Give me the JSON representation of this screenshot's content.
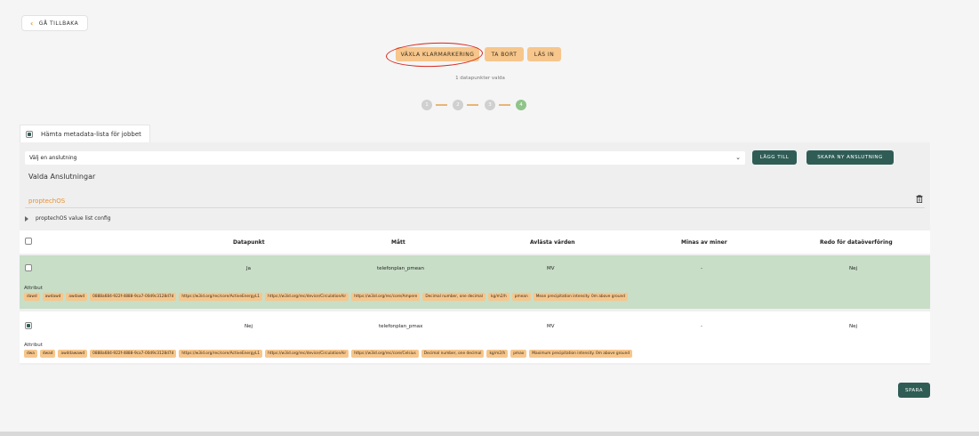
{
  "nav": {
    "back_label": "GÅ TILLBAKA"
  },
  "toolbar": {
    "toggle_label": "VÄXLA KLARMARKERING",
    "delete_label": "TA BORT",
    "read_label": "LÄS IN",
    "selected_count": "1 datapunkter valda"
  },
  "steps": [
    "1",
    "2",
    "3",
    "4"
  ],
  "metadata": {
    "tab_label": "Hämta metadata-lista för jobbet"
  },
  "connection": {
    "select_value": "Välj en anslutning",
    "add_label": "LÄGG TILL",
    "new_label": "SKAPA NY ANSLUTNING",
    "chosen_title": "Valda Anslutningar",
    "name": "proptechOS",
    "config_label": "proptechOS value list config"
  },
  "table": {
    "headers": [
      "Datapunkt",
      "Mått",
      "Avlästa värden",
      "Minas av miner",
      "Redo för dataöverföring"
    ],
    "attr_label": "Attribut",
    "rows": [
      {
        "datapunkt": "Ja",
        "matt": "telefonplan_pmean",
        "avlasta": "MV",
        "minas": "-",
        "redo": "Nej",
        "tags": [
          "dawd",
          "awdawd",
          "awdawd",
          "0888a684-922f-4888-9ca7-00d9c3128d7d",
          "https://w3id.org/rec/core/ActiveEnergyL1",
          "https://w3id.org/rec/device/CirculationAir",
          "https://w3id.org/rec/core/Ampere",
          "Decimal number, one decimal",
          "kg/m2/h",
          "pmean",
          "Mean precipitation intensity. 0m above ground"
        ]
      },
      {
        "datapunkt": "Nej",
        "matt": "telefonplan_pmax",
        "avlasta": "MV",
        "minas": "-",
        "redo": "Nej",
        "tags": [
          "dwa",
          "dwad",
          "awddawawd",
          "0888a684-922f-4888-9ca7-00d9c3128d7d",
          "https://w3id.org/rec/core/ActiveEnergyL1",
          "https://w3id.org/rec/device/CirculationAir",
          "https://w3id.org/rec/core/Celsius",
          "Decimal number, one decimal",
          "kg/m2/h",
          "pmax",
          "Maximum precipitation intensity. 0m above ground"
        ]
      }
    ]
  },
  "footer": {
    "save_label": "SPARA"
  },
  "colors": {
    "accent_orange": "#f6c68c",
    "accent_green": "#2f5d56",
    "row_selected": "#c8dec7",
    "annotation_red": "#d7261e"
  }
}
